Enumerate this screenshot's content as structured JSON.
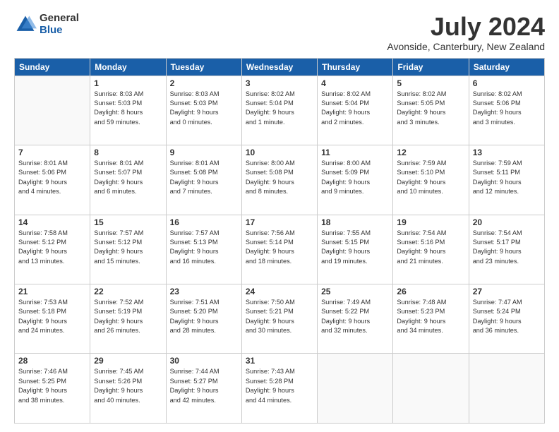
{
  "logo": {
    "general": "General",
    "blue": "Blue"
  },
  "header": {
    "month_year": "July 2024",
    "location": "Avonside, Canterbury, New Zealand"
  },
  "weekdays": [
    "Sunday",
    "Monday",
    "Tuesday",
    "Wednesday",
    "Thursday",
    "Friday",
    "Saturday"
  ],
  "weeks": [
    [
      {
        "day": "",
        "info": ""
      },
      {
        "day": "1",
        "info": "Sunrise: 8:03 AM\nSunset: 5:03 PM\nDaylight: 8 hours\nand 59 minutes."
      },
      {
        "day": "2",
        "info": "Sunrise: 8:03 AM\nSunset: 5:03 PM\nDaylight: 9 hours\nand 0 minutes."
      },
      {
        "day": "3",
        "info": "Sunrise: 8:02 AM\nSunset: 5:04 PM\nDaylight: 9 hours\nand 1 minute."
      },
      {
        "day": "4",
        "info": "Sunrise: 8:02 AM\nSunset: 5:04 PM\nDaylight: 9 hours\nand 2 minutes."
      },
      {
        "day": "5",
        "info": "Sunrise: 8:02 AM\nSunset: 5:05 PM\nDaylight: 9 hours\nand 3 minutes."
      },
      {
        "day": "6",
        "info": "Sunrise: 8:02 AM\nSunset: 5:06 PM\nDaylight: 9 hours\nand 3 minutes."
      }
    ],
    [
      {
        "day": "7",
        "info": "Sunrise: 8:01 AM\nSunset: 5:06 PM\nDaylight: 9 hours\nand 4 minutes."
      },
      {
        "day": "8",
        "info": "Sunrise: 8:01 AM\nSunset: 5:07 PM\nDaylight: 9 hours\nand 6 minutes."
      },
      {
        "day": "9",
        "info": "Sunrise: 8:01 AM\nSunset: 5:08 PM\nDaylight: 9 hours\nand 7 minutes."
      },
      {
        "day": "10",
        "info": "Sunrise: 8:00 AM\nSunset: 5:08 PM\nDaylight: 9 hours\nand 8 minutes."
      },
      {
        "day": "11",
        "info": "Sunrise: 8:00 AM\nSunset: 5:09 PM\nDaylight: 9 hours\nand 9 minutes."
      },
      {
        "day": "12",
        "info": "Sunrise: 7:59 AM\nSunset: 5:10 PM\nDaylight: 9 hours\nand 10 minutes."
      },
      {
        "day": "13",
        "info": "Sunrise: 7:59 AM\nSunset: 5:11 PM\nDaylight: 9 hours\nand 12 minutes."
      }
    ],
    [
      {
        "day": "14",
        "info": "Sunrise: 7:58 AM\nSunset: 5:12 PM\nDaylight: 9 hours\nand 13 minutes."
      },
      {
        "day": "15",
        "info": "Sunrise: 7:57 AM\nSunset: 5:12 PM\nDaylight: 9 hours\nand 15 minutes."
      },
      {
        "day": "16",
        "info": "Sunrise: 7:57 AM\nSunset: 5:13 PM\nDaylight: 9 hours\nand 16 minutes."
      },
      {
        "day": "17",
        "info": "Sunrise: 7:56 AM\nSunset: 5:14 PM\nDaylight: 9 hours\nand 18 minutes."
      },
      {
        "day": "18",
        "info": "Sunrise: 7:55 AM\nSunset: 5:15 PM\nDaylight: 9 hours\nand 19 minutes."
      },
      {
        "day": "19",
        "info": "Sunrise: 7:54 AM\nSunset: 5:16 PM\nDaylight: 9 hours\nand 21 minutes."
      },
      {
        "day": "20",
        "info": "Sunrise: 7:54 AM\nSunset: 5:17 PM\nDaylight: 9 hours\nand 23 minutes."
      }
    ],
    [
      {
        "day": "21",
        "info": "Sunrise: 7:53 AM\nSunset: 5:18 PM\nDaylight: 9 hours\nand 24 minutes."
      },
      {
        "day": "22",
        "info": "Sunrise: 7:52 AM\nSunset: 5:19 PM\nDaylight: 9 hours\nand 26 minutes."
      },
      {
        "day": "23",
        "info": "Sunrise: 7:51 AM\nSunset: 5:20 PM\nDaylight: 9 hours\nand 28 minutes."
      },
      {
        "day": "24",
        "info": "Sunrise: 7:50 AM\nSunset: 5:21 PM\nDaylight: 9 hours\nand 30 minutes."
      },
      {
        "day": "25",
        "info": "Sunrise: 7:49 AM\nSunset: 5:22 PM\nDaylight: 9 hours\nand 32 minutes."
      },
      {
        "day": "26",
        "info": "Sunrise: 7:48 AM\nSunset: 5:23 PM\nDaylight: 9 hours\nand 34 minutes."
      },
      {
        "day": "27",
        "info": "Sunrise: 7:47 AM\nSunset: 5:24 PM\nDaylight: 9 hours\nand 36 minutes."
      }
    ],
    [
      {
        "day": "28",
        "info": "Sunrise: 7:46 AM\nSunset: 5:25 PM\nDaylight: 9 hours\nand 38 minutes."
      },
      {
        "day": "29",
        "info": "Sunrise: 7:45 AM\nSunset: 5:26 PM\nDaylight: 9 hours\nand 40 minutes."
      },
      {
        "day": "30",
        "info": "Sunrise: 7:44 AM\nSunset: 5:27 PM\nDaylight: 9 hours\nand 42 minutes."
      },
      {
        "day": "31",
        "info": "Sunrise: 7:43 AM\nSunset: 5:28 PM\nDaylight: 9 hours\nand 44 minutes."
      },
      {
        "day": "",
        "info": ""
      },
      {
        "day": "",
        "info": ""
      },
      {
        "day": "",
        "info": ""
      }
    ]
  ]
}
